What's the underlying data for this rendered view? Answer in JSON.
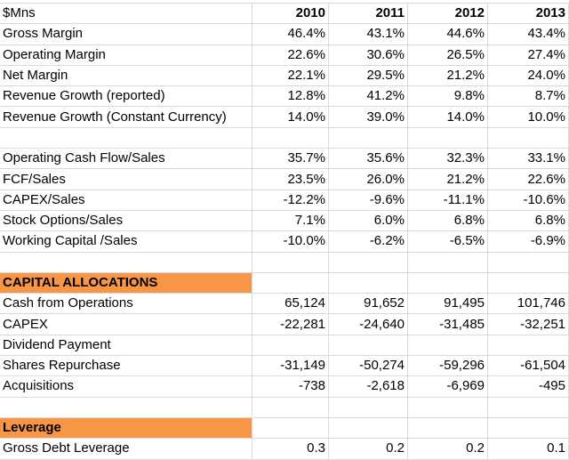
{
  "header": {
    "label": "$Mns",
    "years": [
      "2010",
      "2011",
      "2012",
      "2013"
    ]
  },
  "colors": {
    "section_fill": "#f79646",
    "gridline": "#d9d9d9"
  },
  "ratios": [
    {
      "label": "Gross Margin",
      "values": [
        "46.4%",
        "43.1%",
        "44.6%",
        "43.4%"
      ]
    },
    {
      "label": "Operating Margin",
      "values": [
        "22.6%",
        "30.6%",
        "26.5%",
        "27.4%"
      ]
    },
    {
      "label": "Net Margin",
      "values": [
        "22.1%",
        "29.5%",
        "21.2%",
        "24.0%"
      ]
    },
    {
      "label": "Revenue Growth (reported)",
      "values": [
        "12.8%",
        "41.2%",
        "9.8%",
        "8.7%"
      ]
    },
    {
      "label": "Revenue Growth (Constant Currency)",
      "values": [
        "14.0%",
        "39.0%",
        "14.0%",
        "10.0%"
      ]
    }
  ],
  "cash_ratios": [
    {
      "label": "Operating Cash Flow/Sales",
      "values": [
        "35.7%",
        "35.6%",
        "32.3%",
        "33.1%"
      ]
    },
    {
      "label": "FCF/Sales",
      "values": [
        "23.5%",
        "26.0%",
        "21.2%",
        "22.6%"
      ]
    },
    {
      "label": "CAPEX/Sales",
      "values": [
        "-12.2%",
        "-9.6%",
        "-11.1%",
        "-10.6%"
      ]
    },
    {
      "label": "Stock Options/Sales",
      "values": [
        "7.1%",
        "6.0%",
        "6.8%",
        "6.8%"
      ]
    },
    {
      "label": "Working Capital /Sales",
      "values": [
        "-10.0%",
        "-6.2%",
        "-6.5%",
        "-6.9%"
      ]
    }
  ],
  "capital_allocations": {
    "title": "CAPITAL ALLOCATIONS",
    "rows": [
      {
        "label": "Cash from Operations",
        "values": [
          "65,124",
          "91,652",
          "91,495",
          "101,746"
        ]
      },
      {
        "label": "CAPEX",
        "values": [
          "-22,281",
          "-24,640",
          "-31,485",
          "-32,251"
        ]
      },
      {
        "label": "Dividend Payment",
        "values": [
          "",
          "",
          "",
          ""
        ]
      },
      {
        "label": "Shares Repurchase",
        "values": [
          "-31,149",
          "-50,274",
          "-59,296",
          "-61,504"
        ]
      },
      {
        "label": "Acquisitions",
        "values": [
          "-738",
          "-2,618",
          "-6,969",
          "-495"
        ]
      }
    ]
  },
  "leverage": {
    "title": "Leverage",
    "rows": [
      {
        "label": "Gross Debt Leverage",
        "values": [
          "0.3",
          "0.2",
          "0.2",
          "0.1"
        ]
      }
    ]
  }
}
